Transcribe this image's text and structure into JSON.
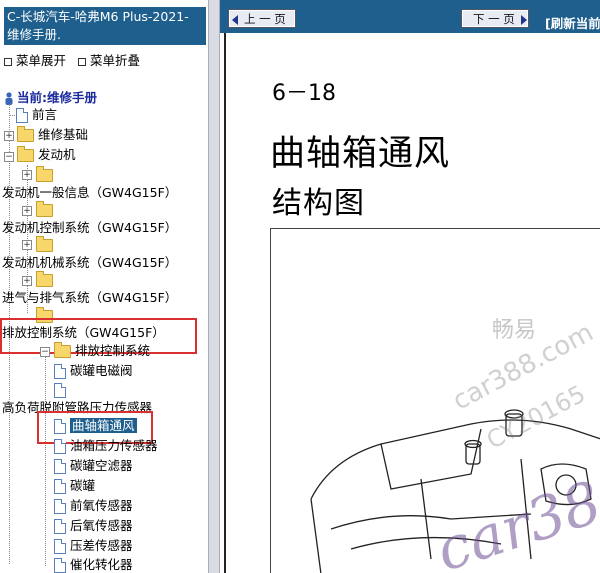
{
  "left": {
    "title": "C-长城汽车-哈弗M6 Plus-2021- 维修手册.",
    "menu_expand": "菜单展开",
    "menu_collapse": "菜单折叠",
    "current": "当前:维修手册",
    "tree": {
      "preface": "前言",
      "basics": "维修基础",
      "engine": "发动机",
      "engine_general": "发动机一般信息（GW4G15F）",
      "engine_control": "发动机控制系统（GW4G15F）",
      "engine_mech": "发动机机械系统（GW4G15F）",
      "intake_exhaust": "进气与排气系统（GW4G15F）",
      "emission": "排放控制系统（GW4G15F）",
      "emission_sys": "排放控制系统",
      "canister_valve": "碳罐电磁阀",
      "hp_sensor": "高负荷脱附管路压力传感器",
      "crankcase_vent": "曲轴箱通风",
      "fuel_tank_sensor": "油箱压力传感器",
      "canister_filter": "碳罐空滤器",
      "canister": "碳罐",
      "front_o2": "前氧传感器",
      "rear_o2": "后氧传感器",
      "diff_pressure": "压差传感器",
      "catalyst": "催化转化器"
    }
  },
  "nav": {
    "prev": "上 一 页",
    "next": "下 一 页",
    "refresh": "[刷新当前"
  },
  "page": {
    "number": "6－18",
    "title": "曲轴箱通风",
    "subtitle": "结构图"
  },
  "watermark": {
    "cn": "畅易",
    "site": "car388.com",
    "code": "CY20165",
    "logo": "car388"
  },
  "colors": {
    "accent": "#1e5f8e",
    "highlight": "#d93030"
  }
}
